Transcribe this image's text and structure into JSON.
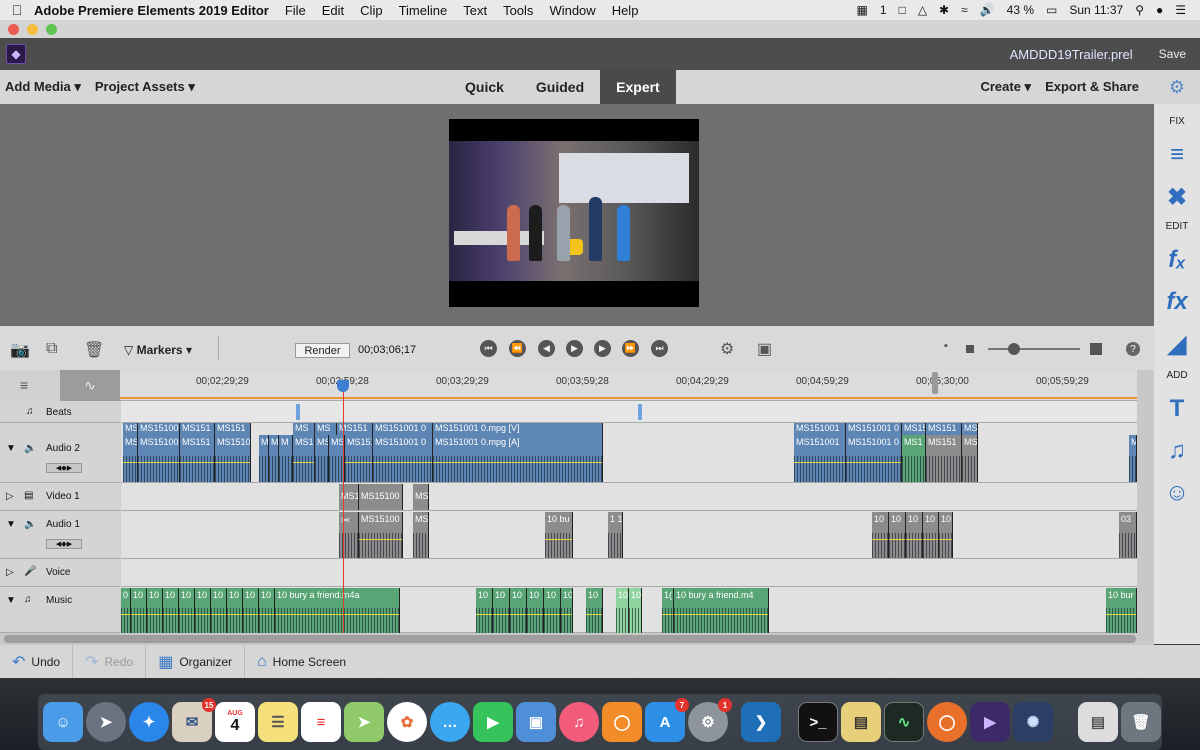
{
  "menubar": {
    "app": "Adobe Premiere Elements 2019 Editor",
    "items": [
      "File",
      "Edit",
      "Clip",
      "Timeline",
      "Text",
      "Tools",
      "Window",
      "Help"
    ],
    "status": {
      "count": "1",
      "battery": "43 %",
      "clock": "Sun 11:37"
    }
  },
  "header": {
    "project": "AMDDD19Trailer.prel",
    "save": "Save"
  },
  "toolbar": {
    "add_media": "Add Media",
    "project_assets": "Project Assets",
    "tabs": [
      "Quick",
      "Guided",
      "Expert"
    ],
    "active_tab": "Expert",
    "create": "Create",
    "export_share": "Export & Share"
  },
  "right_panel": {
    "fix": "FIX",
    "edit": "EDIT",
    "add": "ADD"
  },
  "timeline_bar": {
    "markers": "Markers",
    "render": "Render",
    "timecode": "00;03;06;17"
  },
  "ruler": {
    "ticks": [
      "00;02;29;29",
      "00;02;59;28",
      "00;03;29;29",
      "00;03;59;28",
      "00;04;29;29",
      "00;04;59;29",
      "00;05;30;00",
      "00;05;59;29"
    ]
  },
  "tracks": {
    "beats": "Beats",
    "audio2": "Audio 2",
    "video1": "Video 1",
    "audio1": "Audio 1",
    "voice": "Voice",
    "music": "Music"
  },
  "clips": {
    "a2_top": [
      "MS",
      "MS15100",
      "MS151",
      "MS151",
      "MS",
      "MS",
      "MS151",
      "MS151001 0",
      "MS151001 0.mpg [V]"
    ],
    "a2_top_right": [
      "MS151001",
      "MS151001 0",
      "MS151",
      "MS151",
      "MS"
    ],
    "a2": [
      "MS",
      "MS15100",
      "MS151",
      "MS1510",
      "M",
      "M",
      "M",
      "MS1",
      "MS",
      "MS",
      "MS151",
      "MS151001 0",
      "MS151001 0.mpg [A]"
    ],
    "a2_right": [
      "MS151001",
      "MS151001 0",
      "MS1",
      "MS151",
      "MS",
      "M"
    ],
    "v1": [
      "MS1",
      "MS15100",
      "MS"
    ],
    "a1": [
      "MS15100",
      "MS",
      "10 bu",
      "1 1",
      "10",
      "10",
      "10",
      "10",
      "10",
      "03"
    ],
    "music_left": [
      "0",
      "10",
      "10",
      "10",
      "10",
      "10",
      "10",
      "10",
      "10",
      "10",
      "10 bury a friend.m4a"
    ],
    "music_mid": [
      "10",
      "10",
      "10",
      "10",
      "10",
      "10",
      "10",
      "10",
      "10",
      "1(",
      "10 bury a friend.m4"
    ],
    "music_right": "10 bur"
  },
  "bottom": {
    "undo": "Undo",
    "redo": "Redo",
    "organizer": "Organizer",
    "home": "Home Screen"
  },
  "dock": {
    "calendar_month": "AUG",
    "calendar_day": "4",
    "badges": {
      "mail": "15",
      "appstore": "7",
      "prefs": "1"
    }
  }
}
